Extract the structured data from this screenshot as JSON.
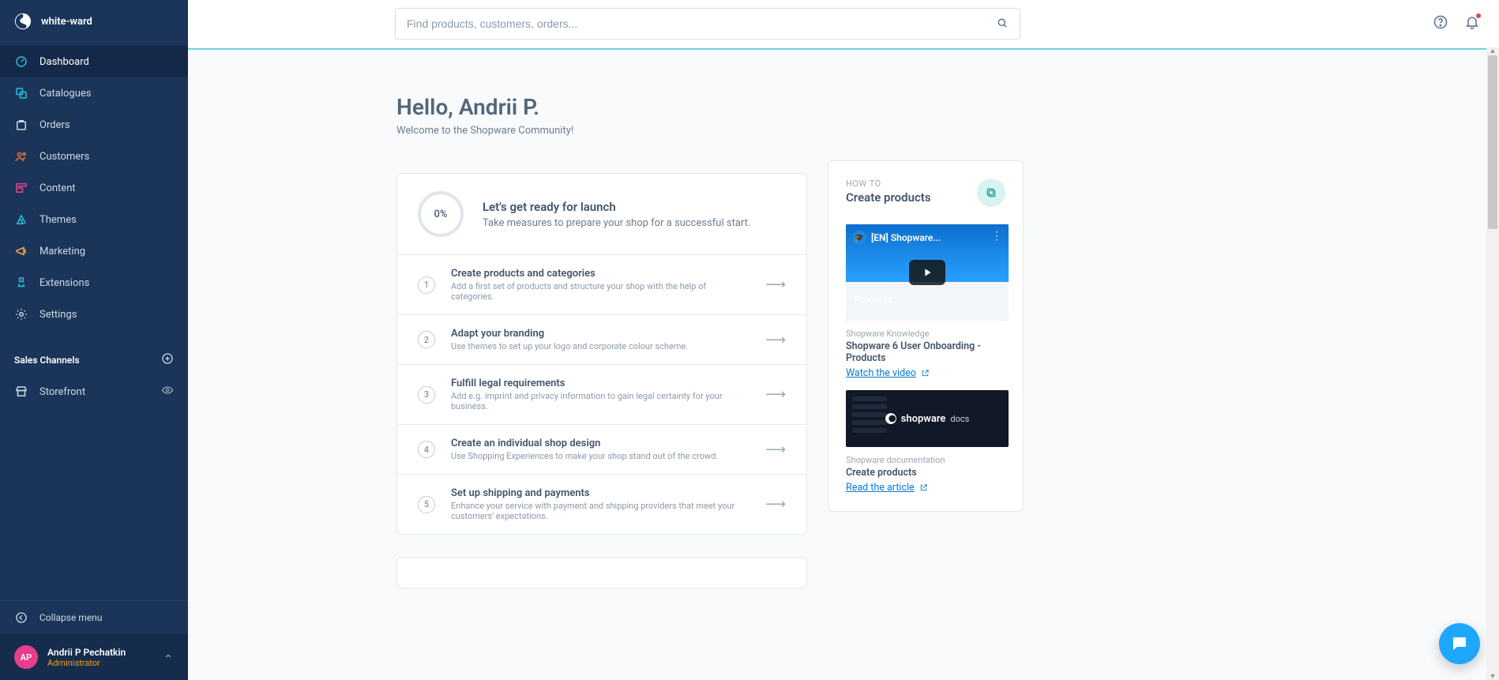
{
  "brand": {
    "name": "white-ward"
  },
  "sidebar": {
    "items": [
      {
        "label": "Dashboard"
      },
      {
        "label": "Catalogues"
      },
      {
        "label": "Orders"
      },
      {
        "label": "Customers"
      },
      {
        "label": "Content"
      },
      {
        "label": "Themes"
      },
      {
        "label": "Marketing"
      },
      {
        "label": "Extensions"
      },
      {
        "label": "Settings"
      }
    ],
    "icon_colors": [
      "#29c0d8",
      "#29c0d8",
      "#cfd8e2",
      "#f4713d",
      "#e83e8c",
      "#29c0d8",
      "#f4a63d",
      "#29c0d8",
      "#cfd8e2"
    ],
    "sales_channels_title": "Sales Channels",
    "channels": [
      {
        "label": "Storefront"
      }
    ],
    "collapse_label": "Collapse menu"
  },
  "user": {
    "initials": "AP",
    "name": "Andrii P Pechatkin",
    "role": "Administrator"
  },
  "search": {
    "placeholder": "Find products, customers, orders..."
  },
  "dashboard": {
    "greeting_title": "Hello, Andrii P.",
    "greeting_sub": "Welcome to the Shopware Community!",
    "progress_percent": "0%",
    "launch_title": "Let's get ready for launch",
    "launch_sub": "Take measures to prepare your shop for a successful start.",
    "steps": [
      {
        "n": "1",
        "title": "Create products and categories",
        "desc": "Add a first set of products and structure your shop with the help of categories."
      },
      {
        "n": "2",
        "title": "Adapt your branding",
        "desc": "Use themes to set up your logo and corporate colour scheme."
      },
      {
        "n": "3",
        "title": "Fulfill legal requirements",
        "desc": "Add e.g. imprint and privacy information to gain legal certainty for your business."
      },
      {
        "n": "4",
        "title": "Create an individual shop design",
        "desc": "Use Shopping Experiences to make your shop stand out of the crowd."
      },
      {
        "n": "5",
        "title": "Set up shipping and payments",
        "desc": "Enhance your service with payment and shipping providers that meet your customers' expectations."
      }
    ]
  },
  "howto": {
    "label": "HOW TO",
    "title": "Create products",
    "video_overlay": "[EN] Shopware...",
    "video_prod": "Products",
    "knowledge_label": "Shopware Knowledge",
    "knowledge_title": "Shopware 6 User Onboarding - Products",
    "watch_video": "Watch the video",
    "docs_label": "Shopware documentation",
    "docs_title": "Create products",
    "read_article": "Read the article",
    "docbox_brand": "shopware",
    "docbox_sub": "docs"
  }
}
